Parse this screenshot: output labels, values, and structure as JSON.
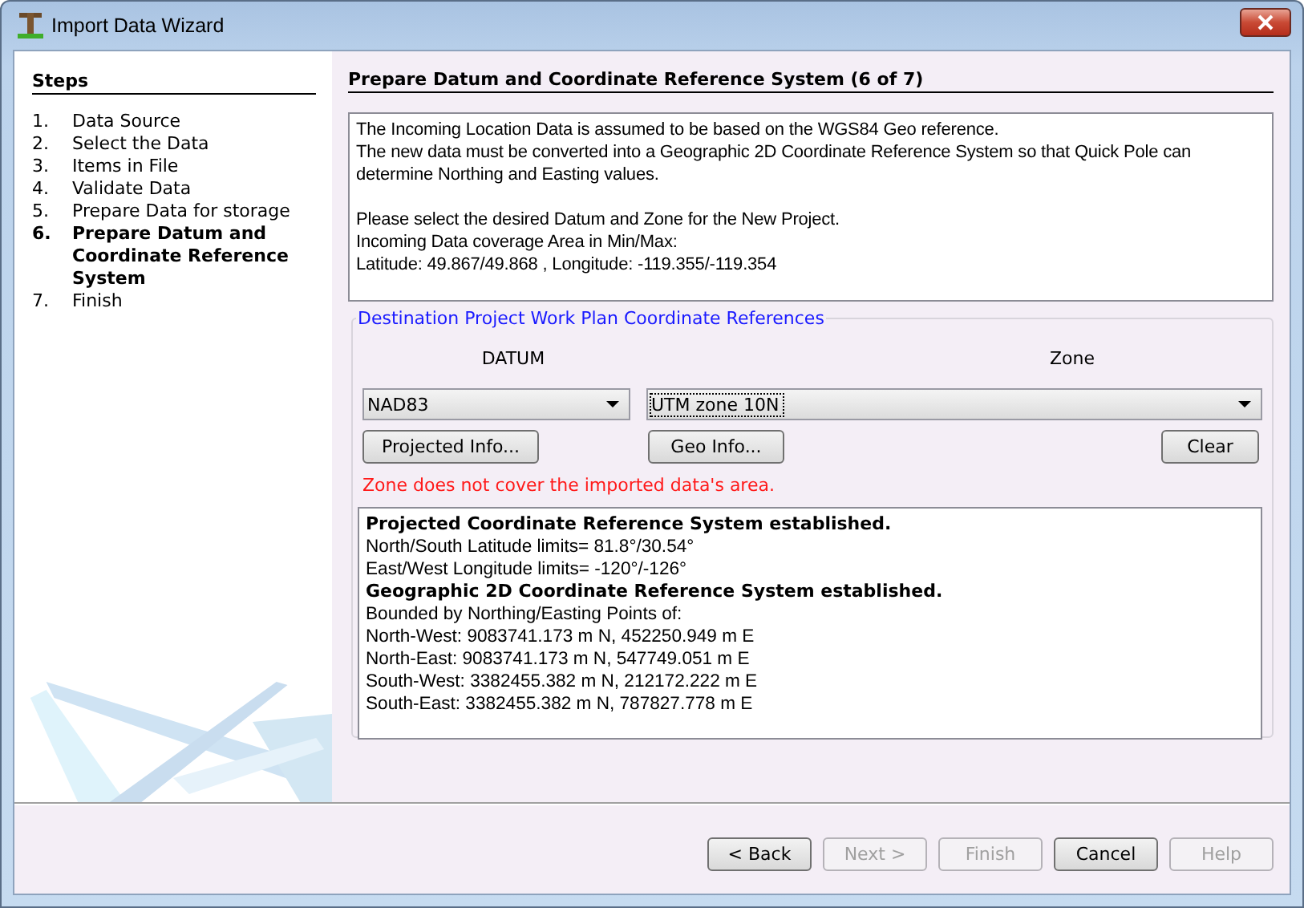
{
  "window": {
    "title": "Import Data Wizard"
  },
  "steps": {
    "title": "Steps",
    "items": [
      {
        "number": "1.",
        "label": "Data Source",
        "selected": false
      },
      {
        "number": "2.",
        "label": "Select the Data",
        "selected": false
      },
      {
        "number": "3.",
        "label": "Items in File",
        "selected": false
      },
      {
        "number": "4.",
        "label": "Validate Data",
        "selected": false
      },
      {
        "number": "5.",
        "label": "Prepare Data for storage",
        "selected": false
      },
      {
        "number": "6.",
        "label": "Prepare Datum and Coordinate Reference System",
        "selected": true
      },
      {
        "number": "7.",
        "label": "Finish",
        "selected": false
      }
    ]
  },
  "page": {
    "title": "Prepare Datum and Coordinate Reference System (6 of 7)",
    "intro": [
      [
        "The Incoming Location Data is assumed to be based on the WGS84 Geo reference.",
        "The new data must be converted into a Geographic 2D Coordinate Reference System so that Quick Pole can determine Northing and Easting values."
      ],
      [
        "Please select the desired Datum and Zone for the New Project.",
        "Incoming Data coverage Area in Min/Max:",
        "Latitude: 49.867/49.868 , Longitude: -119.355/-119.354"
      ]
    ]
  },
  "group": {
    "title": "Destination Project Work Plan Coordinate References",
    "datum": {
      "label": "DATUM",
      "value": "NAD83"
    },
    "zone": {
      "label": "Zone",
      "value": "UTM zone 10N"
    },
    "buttons": {
      "projected": "Projected Info...",
      "geo": "Geo Info...",
      "clear": "Clear"
    },
    "error": "Zone does not cover the imported data's area.",
    "results": [
      {
        "kind": "heading",
        "text": "Projected Coordinate Reference System established."
      },
      {
        "kind": "line",
        "text": "North/South Latitude limits= 81.8°/30.54°"
      },
      {
        "kind": "line",
        "text": "East/West Longitude limits= -120°/-126°"
      },
      {
        "kind": "heading",
        "text": "Geographic 2D Coordinate Reference System established."
      },
      {
        "kind": "line",
        "text": "Bounded by Northing/Easting Points of:"
      },
      {
        "kind": "line",
        "text": "North-West: 9083741.173 m N, 452250.949 m E"
      },
      {
        "kind": "line",
        "text": "North-East: 9083741.173 m N, 547749.051 m E"
      },
      {
        "kind": "line",
        "text": "South-West: 3382455.382 m N, 212172.222 m E"
      },
      {
        "kind": "line",
        "text": "South-East: 3382455.382 m N, 787827.778 m E"
      }
    ]
  },
  "footer": {
    "buttons": [
      {
        "label": "< Back",
        "disabled": false
      },
      {
        "label": "Next >",
        "disabled": true
      },
      {
        "label": "Finish",
        "disabled": true
      },
      {
        "label": "Cancel",
        "disabled": false
      },
      {
        "label": "Help",
        "disabled": true
      }
    ]
  }
}
